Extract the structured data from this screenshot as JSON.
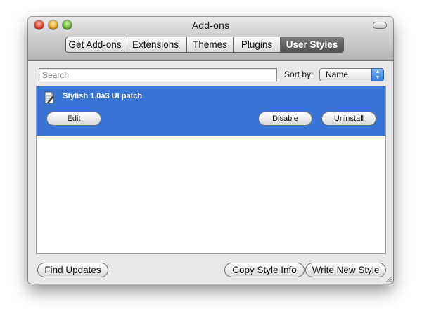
{
  "window": {
    "title": "Add-ons"
  },
  "tabs": [
    {
      "label": "Get Add-ons"
    },
    {
      "label": "Extensions"
    },
    {
      "label": "Themes"
    },
    {
      "label": "Plugins"
    },
    {
      "label": "User Styles",
      "active": true
    }
  ],
  "search": {
    "placeholder": "Search",
    "value": ""
  },
  "sort": {
    "label": "Sort by:",
    "selected": "Name"
  },
  "list": {
    "items": [
      {
        "name": "Stylish 1.0a3 UI patch",
        "icon": "style-sheet-icon",
        "selected": true,
        "buttons": {
          "edit": "Edit",
          "disable": "Disable",
          "uninstall": "Uninstall"
        }
      }
    ]
  },
  "footer": {
    "find_updates": "Find Updates",
    "copy_style_info": "Copy Style Info",
    "write_new_style": "Write New Style"
  },
  "colors": {
    "selection": "#3875d7",
    "active_tab": "#5a5a5a"
  }
}
